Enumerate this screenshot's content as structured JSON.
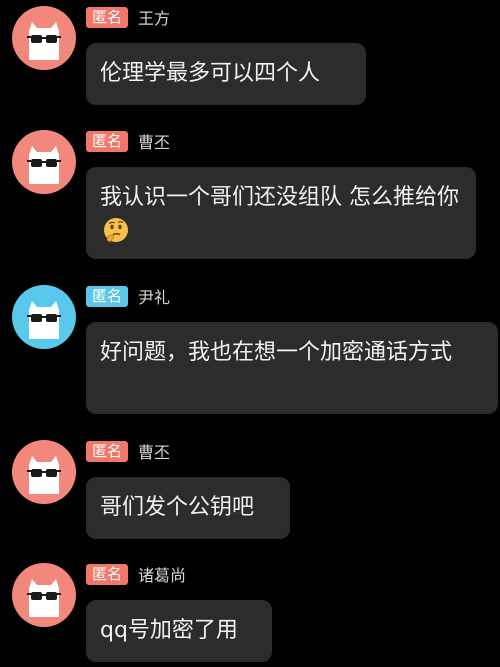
{
  "colors": {
    "background": "#000000",
    "bubble": "#2c2c2c",
    "badge_orange": "#f0776a",
    "badge_blue": "#5cc6e8",
    "avatar_coral": "#f2887c",
    "avatar_cyan": "#58c9ec"
  },
  "messages": [
    {
      "badge": "匿名",
      "badge_color": "orange",
      "avatar_color": "coral",
      "name": "王方",
      "text": "伦理学最多可以四个人"
    },
    {
      "badge": "匿名",
      "badge_color": "orange",
      "avatar_color": "coral",
      "name": "曹丕",
      "text": "我认识一个哥们还没组队 怎么推给你",
      "emoji": "thinking-face-icon"
    },
    {
      "badge": "匿名",
      "badge_color": "blue",
      "avatar_color": "cyan",
      "name": "尹礼",
      "text": "好问题，我也在想一个加密通话方式"
    },
    {
      "badge": "匿名",
      "badge_color": "orange",
      "avatar_color": "coral",
      "name": "曹丕",
      "text": "哥们发个公钥吧"
    },
    {
      "badge": "匿名",
      "badge_color": "orange",
      "avatar_color": "coral",
      "name": "诸葛尚",
      "text": "qq号加密了用"
    }
  ]
}
